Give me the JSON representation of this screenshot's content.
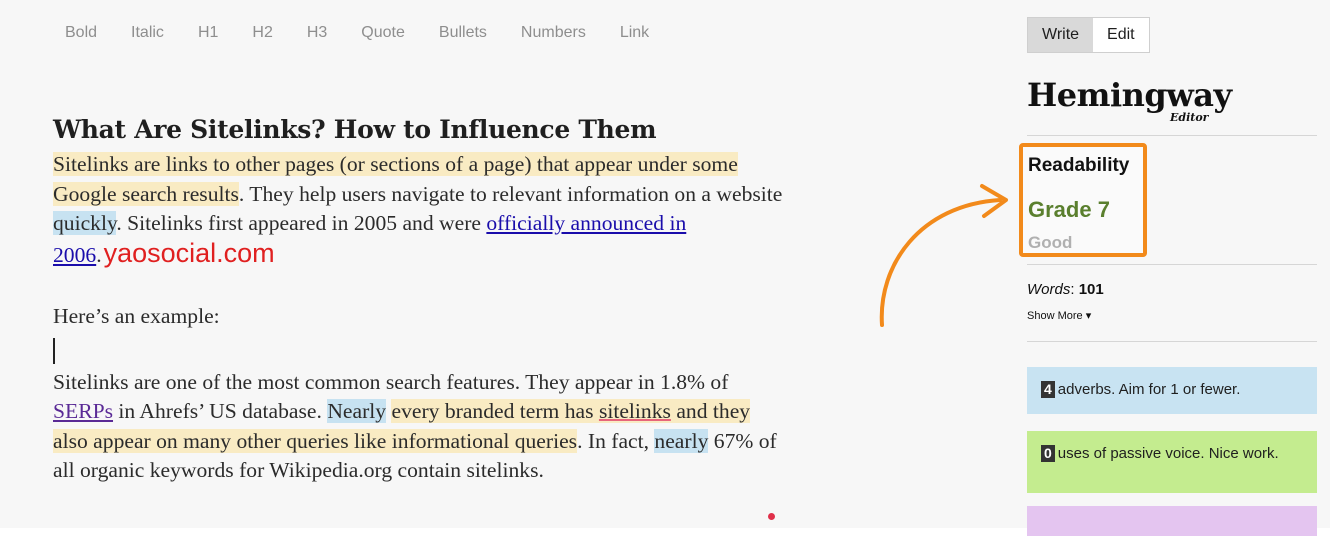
{
  "toolbar": {
    "buttons": [
      "Bold",
      "Italic",
      "H1",
      "H2",
      "H3",
      "Quote",
      "Bullets",
      "Numbers",
      "Link"
    ]
  },
  "editor": {
    "title": "What Are Sitelinks? How to Influence Them",
    "p1": {
      "hl1": "Sitelinks are links to other pages (or sections of a page) that appear under some Google search results",
      "t1": ". They help users navigate to relevant information on a website ",
      "hl2": "quickly",
      "t2": ". Sitelinks first appeared in 2005 and were ",
      "link": "officially announced in 2006",
      "t3": ".",
      "watermark": "yaosocial.com"
    },
    "p2": "Here’s an example:",
    "p3": {
      "t1": "Sitelinks are one of the most common search features. They appear in 1.8% of ",
      "link": "SERPs",
      "t2": " in Ahrefs’ US database. ",
      "hl_nearly1": "Nearly",
      "t3": " ",
      "hl_a": "every branded term has ",
      "squiggle": "sitelinks",
      "hl_b": " and they also appear on many other queries like informational queries",
      "t4": ". In fact, ",
      "hl_nearly2": "nearly",
      "t5": " 67% of all organic keywords for Wikipedia.org contain sitelinks."
    }
  },
  "sidebar": {
    "mode_write": "Write",
    "mode_edit": "Edit",
    "logo": "Hemingway",
    "logo_sub": "Editor",
    "readability_title": "Readability",
    "grade": "Grade 7",
    "grade_word": "Good",
    "words_label": "Words",
    "words_value": "101",
    "show_more": "Show More",
    "adverbs_count": "4",
    "adverbs_text": "adverbs. Aim for 1 or fewer.",
    "passive_count": "0",
    "passive_text": "uses of passive voice. Nice work."
  },
  "colors": {
    "highlight_yellow": "#f9ebc3",
    "highlight_blue": "#c7e2f1",
    "readability_border": "#f28a1b",
    "grade_green": "#5a7f2e",
    "card_blue": "#c8e3f2",
    "card_green": "#c4ec8f",
    "card_purple": "#e4c5f0",
    "watermark_red": "#e02020"
  }
}
